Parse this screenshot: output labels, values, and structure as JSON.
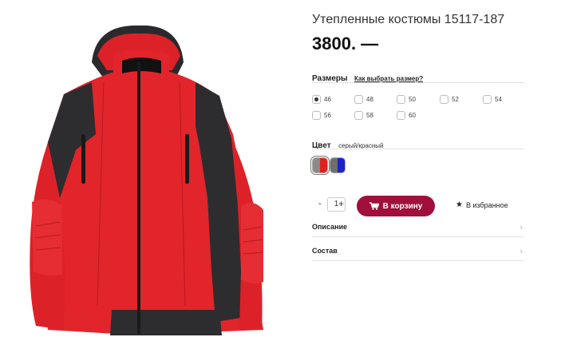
{
  "product": {
    "title": "Утепленные костюмы 15117-187",
    "price": "3800. —",
    "image_alt": "red-black-winter-jacket"
  },
  "sizes": {
    "label": "Размеры",
    "help_link": "Как выбрать размер?",
    "options": [
      "46",
      "48",
      "50",
      "52",
      "54",
      "56",
      "58",
      "60"
    ],
    "selected": "46"
  },
  "color": {
    "label": "Цвет",
    "value": "серый/красный",
    "swatches": [
      {
        "name": "серый/красный",
        "left": "#8a8a8a",
        "right": "#e0221f",
        "selected": true
      },
      {
        "name": "серый/синий",
        "left": "#6f6f6f",
        "right": "#1c24c8",
        "selected": false
      }
    ]
  },
  "buy": {
    "qty_minus": "-",
    "qty_value": "1",
    "qty_plus": "+",
    "cart_label": "В корзину",
    "favorite_label": "В избранное"
  },
  "sections": {
    "description": "Описание",
    "composition": "Состав"
  },
  "colors": {
    "accent": "#a0103b"
  }
}
